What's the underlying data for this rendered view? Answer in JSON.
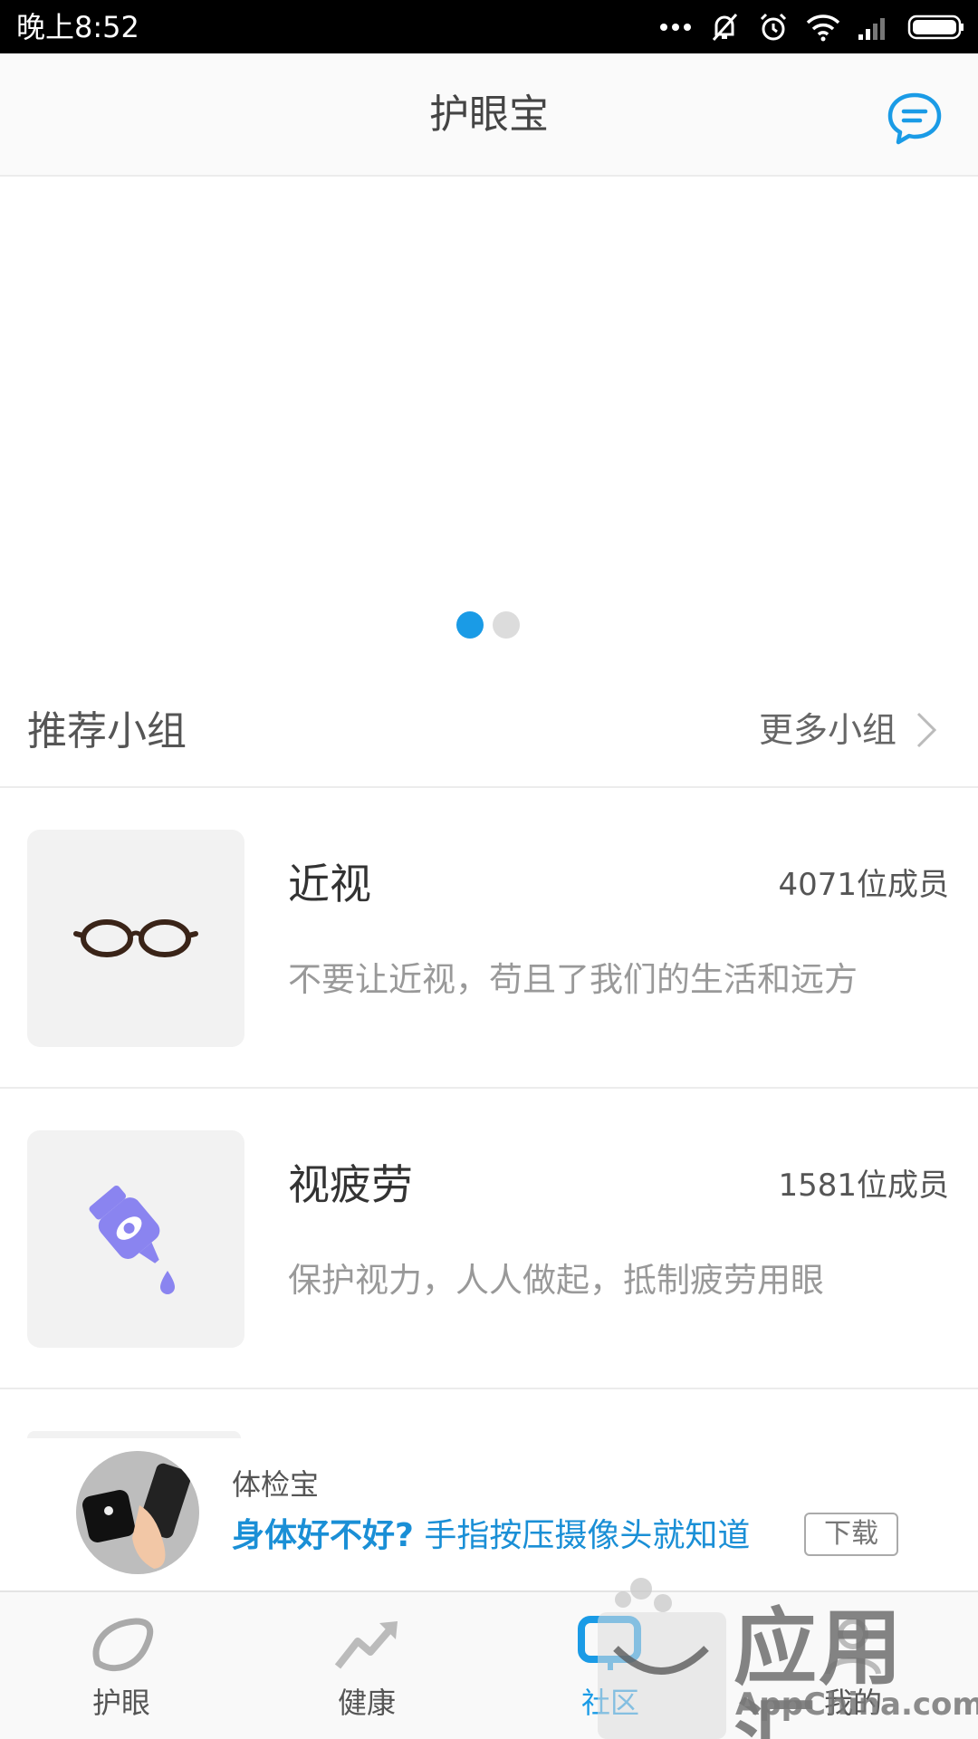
{
  "status_bar": {
    "time": "晚上8:52",
    "icons": [
      "more-dots-icon",
      "mute-icon",
      "alarm-icon",
      "wifi-icon",
      "signal-icon",
      "battery-icon"
    ]
  },
  "header": {
    "title": "护眼宝",
    "message_icon": "chat-bubble-icon"
  },
  "banner": {
    "page_count": 2,
    "active_page": 1
  },
  "section": {
    "title": "推荐小组",
    "more_label": "更多小组"
  },
  "groups": [
    {
      "name": "近视",
      "members": "4071位成员",
      "description": "不要让近视，苟且了我们的生活和远方",
      "icon": "glasses-icon"
    },
    {
      "name": "视疲劳",
      "members": "1581位成员",
      "description": "保护视力，人人做起，抵制疲劳用眼",
      "icon": "eye-drops-icon"
    }
  ],
  "ad": {
    "app_name": "体检宝",
    "slogan_question": "身体好不好?",
    "slogan_rest": " 手指按压摄像头就知道",
    "download_label": "下载"
  },
  "bottom_nav": {
    "items": [
      {
        "label": "护眼",
        "icon": "eye-shape-icon"
      },
      {
        "label": "健康",
        "icon": "trend-up-icon"
      },
      {
        "label": "社区",
        "icon": "community-icon",
        "active": true
      },
      {
        "label": "我的",
        "icon": "profile-icon"
      }
    ]
  },
  "watermark": {
    "cn": "应用汇",
    "en": "AppChina.com"
  },
  "colors": {
    "accent": "#1a9be6",
    "glasses": "#3a2418",
    "eye_drops": "#8a84f0"
  }
}
